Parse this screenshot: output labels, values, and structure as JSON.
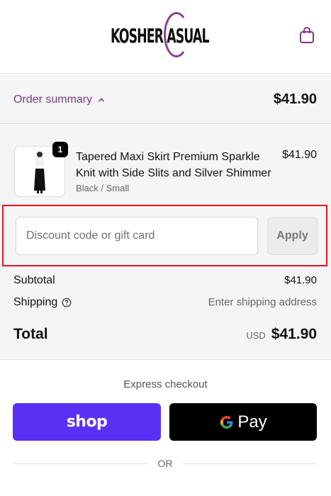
{
  "brand": {
    "logo_text_left": "KOSHER",
    "logo_text_right": "ASUAL",
    "accent_color": "#7c3a86"
  },
  "cart": {
    "icon": "shopping-bag-icon"
  },
  "summary": {
    "toggle_label": "Order summary",
    "toggle_icon": "chevron-up-icon",
    "total": "$41.90"
  },
  "product": {
    "quantity": "1",
    "name": "Tapered Maxi Skirt Premium Sparkle Knit with Side Slits and Silver Shimmer",
    "variant": "Black / Small",
    "price": "$41.90"
  },
  "discount": {
    "placeholder": "Discount code or gift card",
    "value": "",
    "apply_label": "Apply"
  },
  "totals": {
    "subtotal_label": "Subtotal",
    "subtotal_value": "$41.90",
    "shipping_label": "Shipping",
    "shipping_icon": "question-circle-icon",
    "shipping_value": "Enter shipping address",
    "total_label": "Total",
    "currency": "USD",
    "total_value": "$41.90"
  },
  "express": {
    "title": "Express checkout",
    "shop_label": "shop",
    "gpay_label": "Pay",
    "shop_color": "#5a31f4",
    "or_label": "OR"
  }
}
